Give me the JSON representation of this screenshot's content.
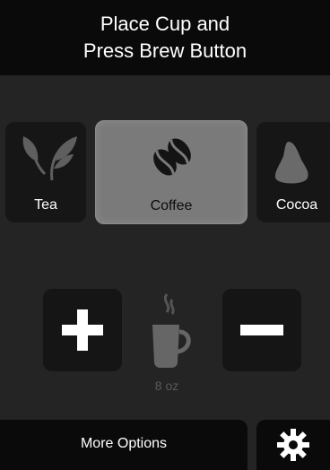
{
  "header": {
    "line1": "Place Cup and",
    "line2": "Press Brew Button"
  },
  "beverages": [
    {
      "label": "Tea",
      "icon": "leaf-icon",
      "selected": false
    },
    {
      "label": "Coffee",
      "icon": "coffee-beans-icon",
      "selected": true
    },
    {
      "label": "Cocoa",
      "icon": "cocoa-icon",
      "selected": false
    }
  ],
  "size": {
    "value": "8 oz",
    "increase_icon": "plus-icon",
    "decrease_icon": "minus-icon",
    "cup_icon": "cup-icon"
  },
  "footer": {
    "more_options_label": "More Options",
    "settings_icon": "gear-icon"
  },
  "colors": {
    "background": "#242424",
    "header": "#0a0a0a",
    "tile": "#161616",
    "selected_tile": "#7a7a7a",
    "icon_muted": "#666666",
    "text": "#ffffff"
  }
}
